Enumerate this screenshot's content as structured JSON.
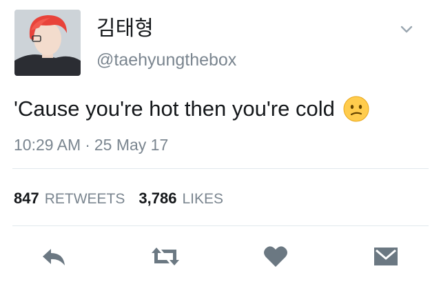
{
  "tweet": {
    "display_name": "김태형",
    "handle": "@taehyungthebox",
    "text": "'Cause you're hot then you're cold",
    "emoji": "confused-face",
    "time": "10:29 AM",
    "separator": "·",
    "date": "25 May 17"
  },
  "stats": {
    "retweets_count": "847",
    "retweets_label": "RETWEETS",
    "likes_count": "3,786",
    "likes_label": "LIKES"
  },
  "actions": {
    "reply_icon": "reply-icon",
    "retweet_icon": "retweet-icon",
    "like_icon": "heart-icon",
    "message_icon": "direct-message-icon"
  },
  "colors": {
    "text_primary": "#14171a",
    "text_secondary": "#7a858f",
    "icon_gray": "#6b7882",
    "avatar_hair": "#e8433a",
    "divider": "#e1e8ed",
    "emoji_yellow": "#ffcc4d"
  }
}
